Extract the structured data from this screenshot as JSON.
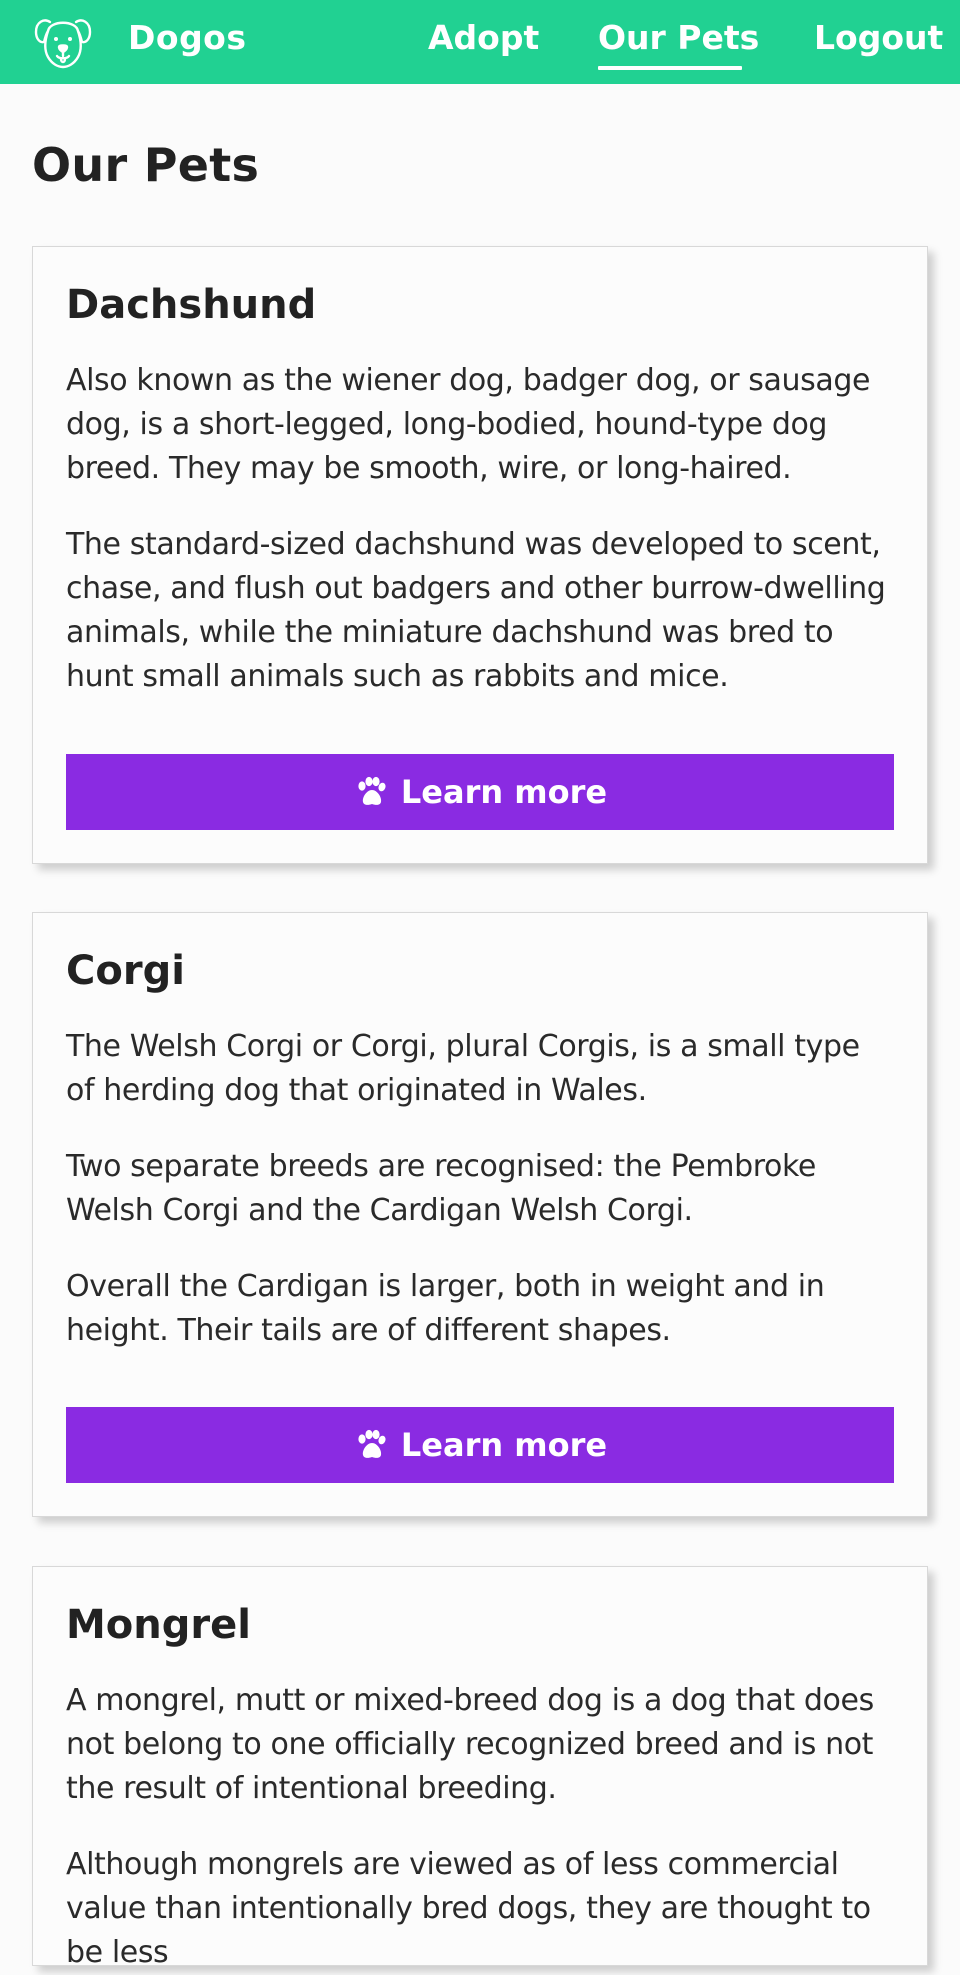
{
  "nav": {
    "brand": "Dogos",
    "logo_icon": "dog-face-icon",
    "links": [
      {
        "label": "Adopt",
        "active": false
      },
      {
        "label": "Our Pets",
        "active": true
      },
      {
        "label": "Logout",
        "active": false
      }
    ]
  },
  "page": {
    "title": "Our Pets"
  },
  "cards": [
    {
      "title": "Dachshund",
      "paragraphs": [
        "Also known as the wiener dog, badger dog, or sausage dog, is a short-legged, long-bodied, hound-type dog breed. They may be smooth, wire, or long-haired.",
        "The standard-sized dachshund was developed to scent, chase, and flush out badgers and other burrow-dwelling animals, while the miniature dachshund was bred to hunt small animals such as rabbits and mice."
      ],
      "button_label": "Learn more",
      "button_icon": "paw-icon"
    },
    {
      "title": "Corgi",
      "paragraphs": [
        "The Welsh Corgi or Corgi, plural Corgis, is a small type of herding dog that originated in Wales.",
        "Two separate breeds are recognised: the Pembroke Welsh Corgi and the Cardigan Welsh Corgi.",
        "Overall the Cardigan is larger, both in weight and in height. Their tails are of different shapes."
      ],
      "button_label": "Learn more",
      "button_icon": "paw-icon"
    },
    {
      "title": "Mongrel",
      "paragraphs": [
        "A mongrel, mutt or mixed-breed dog is a dog that does not belong to one officially recognized breed and is not the result of intentional breeding.",
        "Although mongrels are viewed as of less commercial value than intentionally bred dogs, they are thought to be less"
      ]
    }
  ],
  "colors": {
    "navbar": "#21d192",
    "button": "#8a2be2",
    "background": "#fbfbfb"
  }
}
